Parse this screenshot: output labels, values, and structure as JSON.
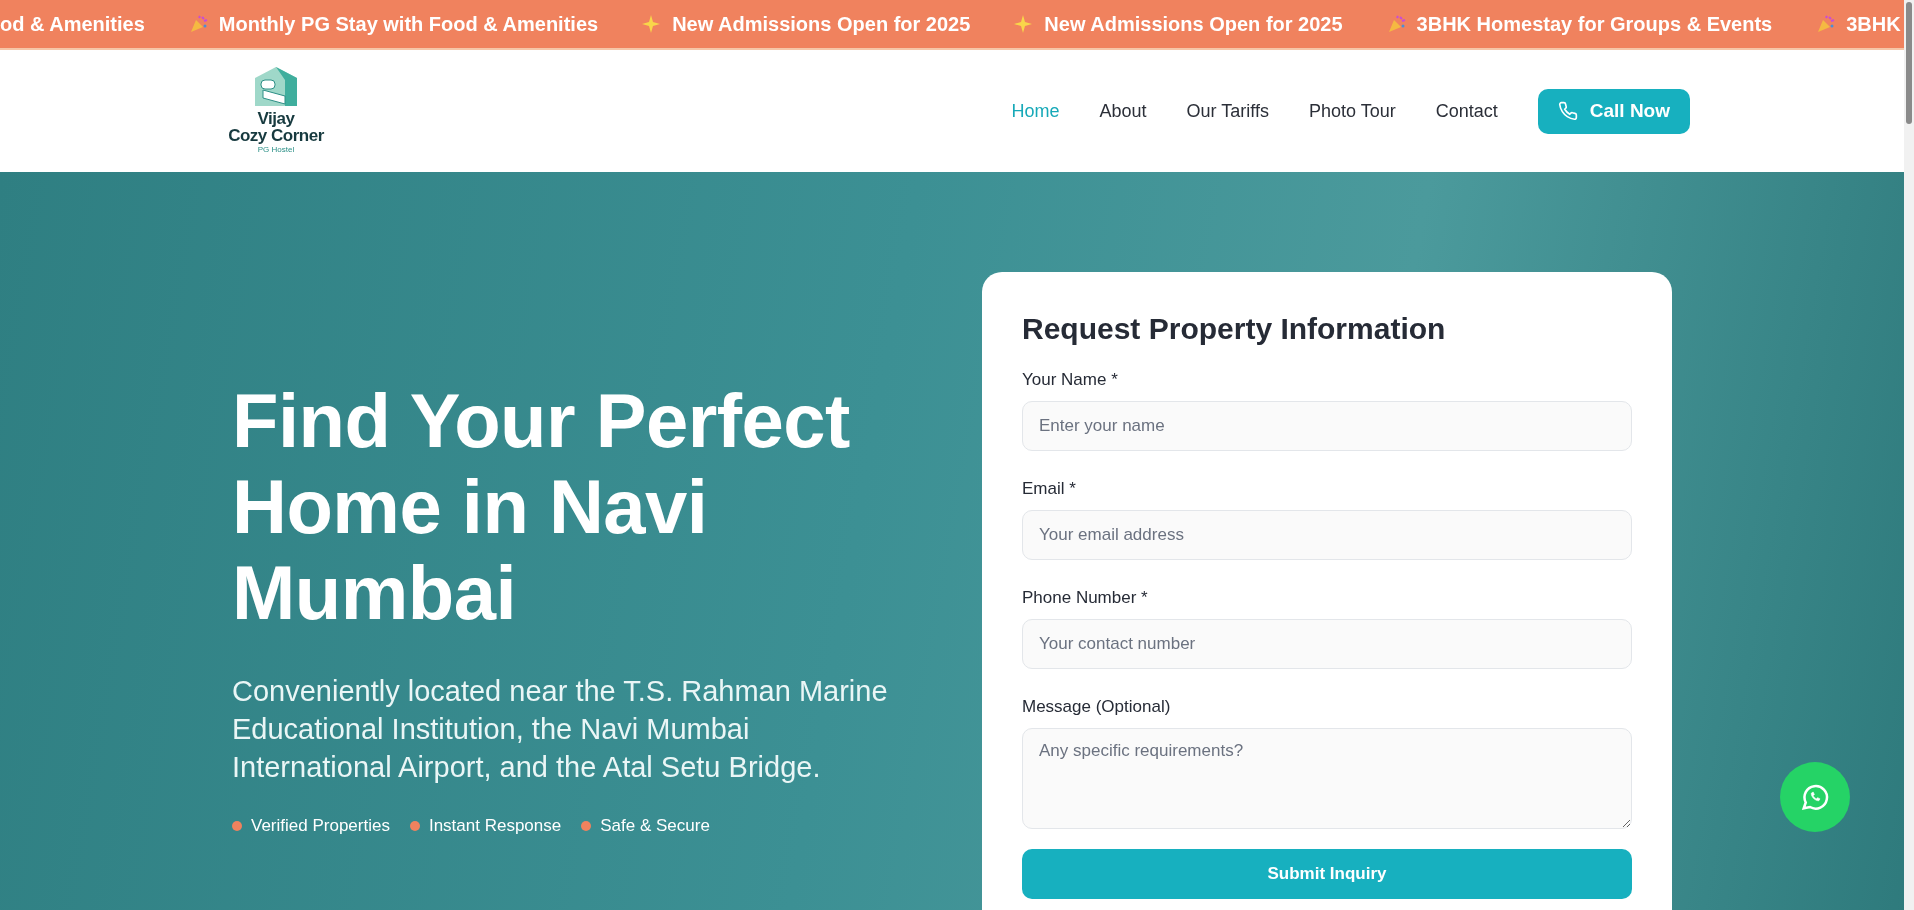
{
  "announcements": [
    {
      "kind": "none",
      "text": "od & Amenities"
    },
    {
      "kind": "party",
      "text": "Monthly PG Stay with Food & Amenities"
    },
    {
      "kind": "sparkle",
      "text": "New Admissions Open for 2025"
    },
    {
      "kind": "sparkle",
      "text": "New Admissions Open for 2025"
    },
    {
      "kind": "party",
      "text": "3BHK Homestay for Groups & Events"
    },
    {
      "kind": "party",
      "text": "3BHK"
    }
  ],
  "logo": {
    "name_line_1": "Vijay",
    "name_line_2": "Cozy Corner",
    "tagline": "PG Hostel"
  },
  "nav": [
    {
      "label": "Home",
      "selected": true
    },
    {
      "label": "About",
      "selected": false
    },
    {
      "label": "Our Tariffs",
      "selected": false
    },
    {
      "label": "Photo Tour",
      "selected": false
    },
    {
      "label": "Contact",
      "selected": false
    }
  ],
  "call_button": "Call Now",
  "hero": {
    "title": "Find Your Perfect Home in Navi Mumbai",
    "subtitle": "Conveniently located near the T.S. Rahman Marine Educational Institution, the Navi Mumbai International Airport, and the Atal Setu Bridge.",
    "features": [
      "Verified Properties",
      "Instant Response",
      "Safe & Secure"
    ]
  },
  "form": {
    "title": "Request Property Information",
    "fields": [
      {
        "kind": "input",
        "label": "Your Name *",
        "placeholder": "Enter your name"
      },
      {
        "kind": "input",
        "label": "Email *",
        "placeholder": "Your email address"
      },
      {
        "kind": "input",
        "label": "Phone Number *",
        "placeholder": "Your contact number"
      },
      {
        "kind": "textarea",
        "label": "Message (Optional)",
        "placeholder": "Any specific requirements?"
      }
    ],
    "submit": "Submit Inquiry"
  }
}
